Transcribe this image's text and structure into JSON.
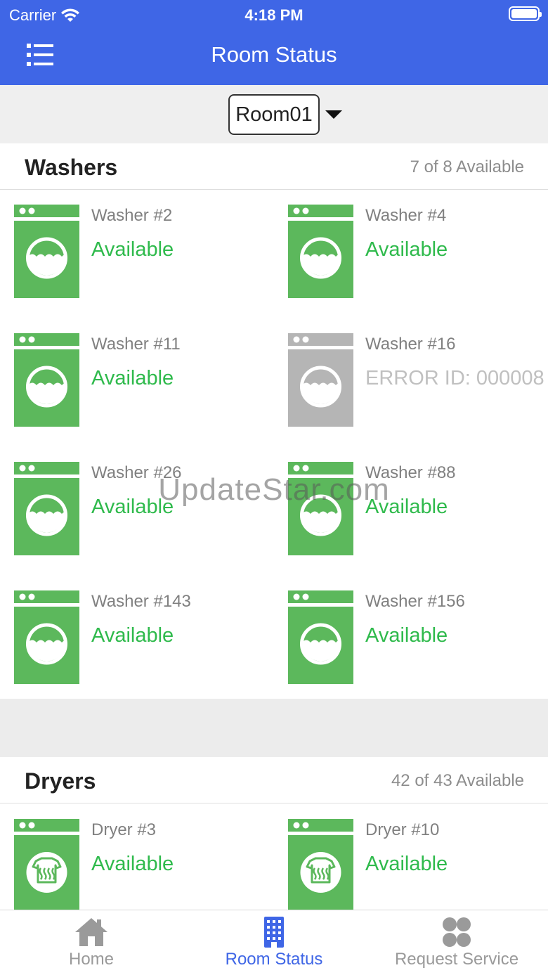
{
  "status_bar": {
    "carrier": "Carrier",
    "time": "4:18 PM"
  },
  "header": {
    "title": "Room Status",
    "menu_icon": "menu-list-icon"
  },
  "room_selector": {
    "selected": "Room01"
  },
  "washers": {
    "title": "Washers",
    "count": "7 of 8 Available",
    "items": [
      {
        "name": "Washer #2",
        "status": "Available",
        "state": "available"
      },
      {
        "name": "Washer #4",
        "status": "Available",
        "state": "available"
      },
      {
        "name": "Washer #11",
        "status": "Available",
        "state": "available"
      },
      {
        "name": "Washer #16",
        "status": "ERROR ID: 000008",
        "state": "error"
      },
      {
        "name": "Washer #26",
        "status": "Available",
        "state": "available"
      },
      {
        "name": "Washer #88",
        "status": "Available",
        "state": "available"
      },
      {
        "name": "Washer #143",
        "status": "Available",
        "state": "available"
      },
      {
        "name": "Washer #156",
        "status": "Available",
        "state": "available"
      }
    ]
  },
  "dryers": {
    "title": "Dryers",
    "count": "42 of 43 Available",
    "items": [
      {
        "name": "Dryer #3",
        "status": "Available",
        "state": "available"
      },
      {
        "name": "Dryer #10",
        "status": "Available",
        "state": "available"
      }
    ]
  },
  "watermark": "UpdateStar.com",
  "tabs": [
    {
      "label": "Home",
      "icon": "home-icon",
      "active": false
    },
    {
      "label": "Room Status",
      "icon": "building-icon",
      "active": true
    },
    {
      "label": "Request Service",
      "icon": "clover-icon",
      "active": false
    }
  ],
  "colors": {
    "header": "#3f66e6",
    "available": "#2fba4c",
    "machine_green": "#5cb85c",
    "machine_gray": "#b5b5b5",
    "error_text": "#c0c0c0"
  }
}
